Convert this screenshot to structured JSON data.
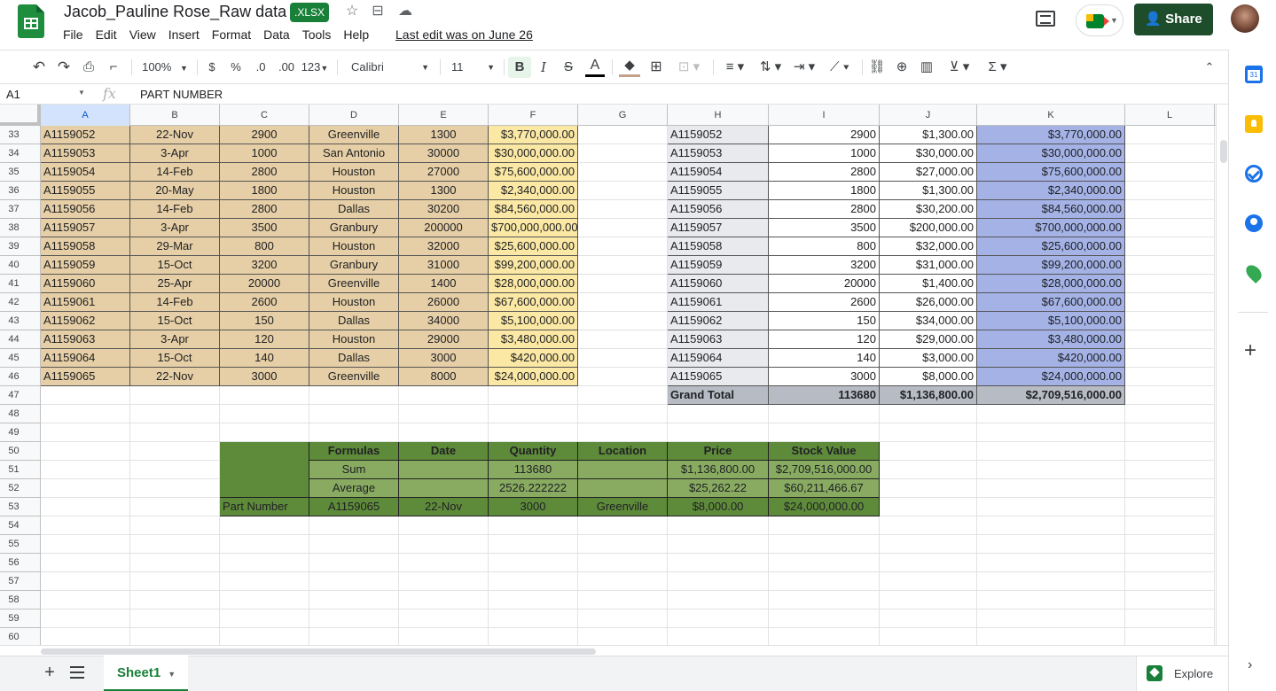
{
  "app": {
    "title": "Jacob_Pauline Rose_Raw data",
    "file_badge": ".XLSX",
    "last_edit": "Last edit was on June 26",
    "share_label": "Share",
    "menus": [
      "File",
      "Edit",
      "View",
      "Insert",
      "Format",
      "Data",
      "Tools",
      "Help"
    ]
  },
  "toolbar": {
    "zoom": "100%",
    "currency": "$",
    "percent": "%",
    "dec_decrease": ".0",
    "dec_increase": ".00",
    "more_formats": "123",
    "font": "Calibri",
    "font_size": "11",
    "bold": "B",
    "italic": "I",
    "strikethrough": "S",
    "text_color": "A"
  },
  "formula_bar": {
    "name_box": "A1",
    "fx_label": "fx",
    "content": "PART NUMBER"
  },
  "columns": [
    "A",
    "B",
    "C",
    "D",
    "E",
    "F",
    "G",
    "H",
    "I",
    "J",
    "K",
    "L"
  ],
  "selected_column": "A",
  "row_numbers": [
    "33",
    "34",
    "35",
    "36",
    "37",
    "38",
    "39",
    "40",
    "41",
    "42",
    "43",
    "44",
    "45",
    "46",
    "47",
    "48",
    "49",
    "50",
    "51",
    "52",
    "53",
    "54",
    "55",
    "56",
    "57",
    "58",
    "59",
    "60"
  ],
  "left_table": [
    [
      "A1159052",
      "22-Nov",
      "2900",
      "Greenville",
      "1300",
      "$3,770,000.00"
    ],
    [
      "A1159053",
      "3-Apr",
      "1000",
      "San Antonio",
      "30000",
      "$30,000,000.00"
    ],
    [
      "A1159054",
      "14-Feb",
      "2800",
      "Houston",
      "27000",
      "$75,600,000.00"
    ],
    [
      "A1159055",
      "20-May",
      "1800",
      "Houston",
      "1300",
      "$2,340,000.00"
    ],
    [
      "A1159056",
      "14-Feb",
      "2800",
      "Dallas",
      "30200",
      "$84,560,000.00"
    ],
    [
      "A1159057",
      "3-Apr",
      "3500",
      "Granbury",
      "200000",
      "$700,000,000.00"
    ],
    [
      "A1159058",
      "29-Mar",
      "800",
      "Houston",
      "32000",
      "$25,600,000.00"
    ],
    [
      "A1159059",
      "15-Oct",
      "3200",
      "Granbury",
      "31000",
      "$99,200,000.00"
    ],
    [
      "A1159060",
      "25-Apr",
      "20000",
      "Greenville",
      "1400",
      "$28,000,000.00"
    ],
    [
      "A1159061",
      "14-Feb",
      "2600",
      "Houston",
      "26000",
      "$67,600,000.00"
    ],
    [
      "A1159062",
      "15-Oct",
      "150",
      "Dallas",
      "34000",
      "$5,100,000.00"
    ],
    [
      "A1159063",
      "3-Apr",
      "120",
      "Houston",
      "29000",
      "$3,480,000.00"
    ],
    [
      "A1159064",
      "15-Oct",
      "140",
      "Dallas",
      "3000",
      "$420,000.00"
    ],
    [
      "A1159065",
      "22-Nov",
      "3000",
      "Greenville",
      "8000",
      "$24,000,000.00"
    ]
  ],
  "pivot_table": [
    [
      "A1159052",
      "2900",
      "$1,300.00",
      "$3,770,000.00"
    ],
    [
      "A1159053",
      "1000",
      "$30,000.00",
      "$30,000,000.00"
    ],
    [
      "A1159054",
      "2800",
      "$27,000.00",
      "$75,600,000.00"
    ],
    [
      "A1159055",
      "1800",
      "$1,300.00",
      "$2,340,000.00"
    ],
    [
      "A1159056",
      "2800",
      "$30,200.00",
      "$84,560,000.00"
    ],
    [
      "A1159057",
      "3500",
      "$200,000.00",
      "$700,000,000.00"
    ],
    [
      "A1159058",
      "800",
      "$32,000.00",
      "$25,600,000.00"
    ],
    [
      "A1159059",
      "3200",
      "$31,000.00",
      "$99,200,000.00"
    ],
    [
      "A1159060",
      "20000",
      "$1,400.00",
      "$28,000,000.00"
    ],
    [
      "A1159061",
      "2600",
      "$26,000.00",
      "$67,600,000.00"
    ],
    [
      "A1159062",
      "150",
      "$34,000.00",
      "$5,100,000.00"
    ],
    [
      "A1159063",
      "120",
      "$29,000.00",
      "$3,480,000.00"
    ],
    [
      "A1159064",
      "140",
      "$3,000.00",
      "$420,000.00"
    ],
    [
      "A1159065",
      "3000",
      "$8,000.00",
      "$24,000,000.00"
    ]
  ],
  "grand_total": [
    "Grand Total",
    "113680",
    "$1,136,800.00",
    "$2,709,516,000.00"
  ],
  "summary": {
    "header": [
      "Formulas",
      "Date",
      "Quantity",
      "Location",
      "Price",
      "Stock Value"
    ],
    "sum": [
      "Sum",
      "",
      "113680",
      "",
      "$1,136,800.00",
      "$2,709,516,000.00"
    ],
    "average": [
      "Average",
      "",
      "2526.222222",
      "",
      "$25,262.22",
      "$60,211,466.67"
    ],
    "part_label": "Part Number",
    "part_row": [
      "A1159065",
      "22-Nov",
      "3000",
      "Greenville",
      "$8,000.00",
      "$24,000,000.00"
    ]
  },
  "bottom": {
    "sheet_tab": "Sheet1",
    "explore": "Explore"
  }
}
